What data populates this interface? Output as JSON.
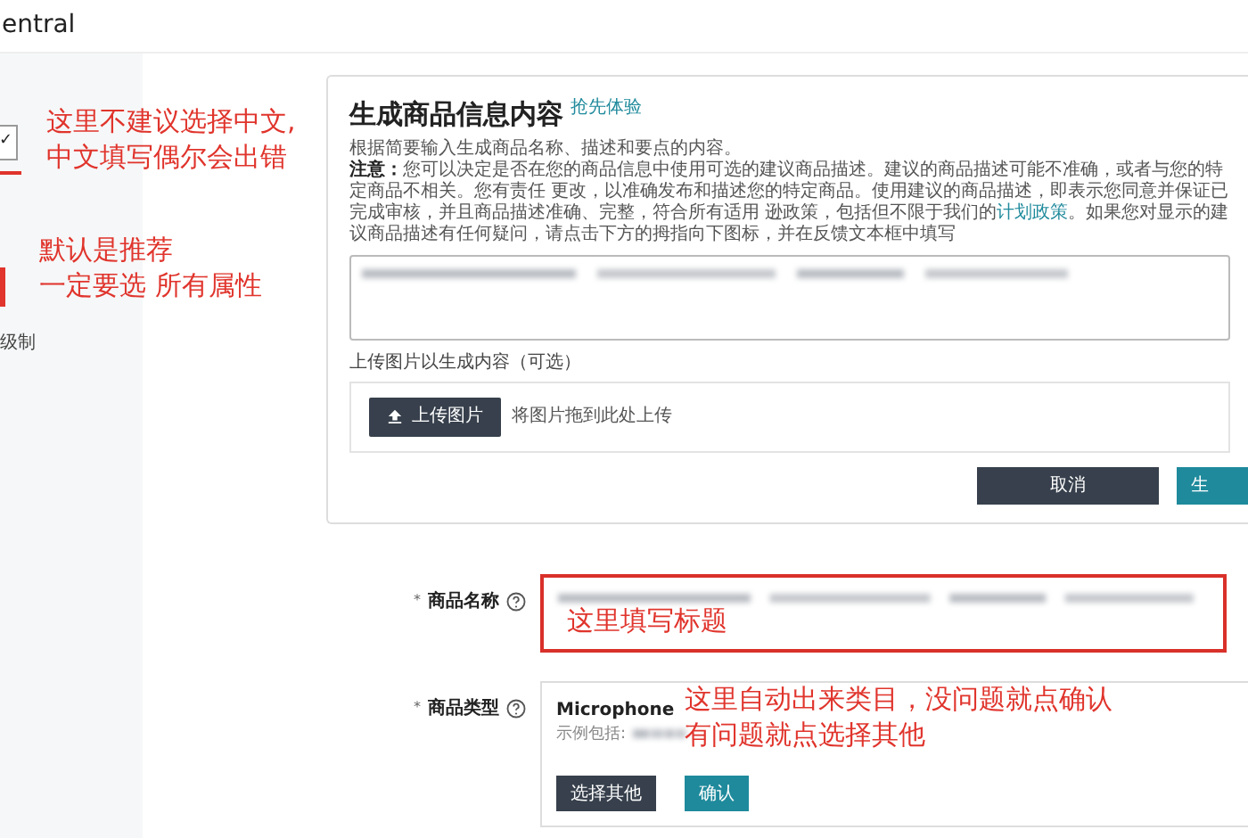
{
  "header": {
    "brand": "entral"
  },
  "sidebar": {
    "dropdown_mark": "✓",
    "footer_text": "级制"
  },
  "generator": {
    "title": "生成商品信息内容",
    "badge": "抢先体验",
    "intro": "根据简要输入生成商品名称、描述和要点的内容。",
    "note": {
      "label": "注意：",
      "text_before": "您可以决定是否在您的商品信息中使用可选的建议商品描述。建议的商品描述可能不准确，或者与您的特定商品不相关。您有责任 更改，以准确发布和描述您的特定商品。使用建议的商品描述，即表示您同意并保证已完成审核，并且商品描述准确、完整，符合所有适用 逊政策，包括但不限于我们的",
      "link": "计划政策",
      "text_after": "。如果您对显示的建议商品描述有任何疑问，请点击下方的拇指向下图标，并在反馈文本框中填写"
    },
    "upload_label": "上传图片以生成内容（可选）",
    "upload_button": "上传图片",
    "upload_hint": "将图片拖到此处上传",
    "buttons": [
      {
        "label": "取消",
        "kind": "secondary"
      },
      {
        "label": "生",
        "kind": "primary"
      }
    ]
  },
  "fields": [
    {
      "required": "*",
      "label": "商品名称",
      "kind": "text",
      "highlighted": true
    },
    {
      "required": "*",
      "label": "商品类型",
      "kind": "category",
      "category": "Microphone",
      "examples_label": "示例包括:",
      "buttons": [
        {
          "label": "选择其他",
          "kind": "secondary"
        },
        {
          "label": "确认",
          "kind": "primary"
        }
      ]
    }
  ],
  "annotations": [
    {
      "lines": [
        "这里不建议选择中文,",
        "中文填写偶尔会出错"
      ]
    },
    {
      "lines": [
        "默认是推荐",
        "一定要选 所有属性"
      ]
    },
    {
      "lines": [
        "这里填写标题"
      ]
    },
    {
      "lines": [
        "这里自动出来类目，没问题就点确认",
        "有问题就点选择其他"
      ]
    }
  ]
}
